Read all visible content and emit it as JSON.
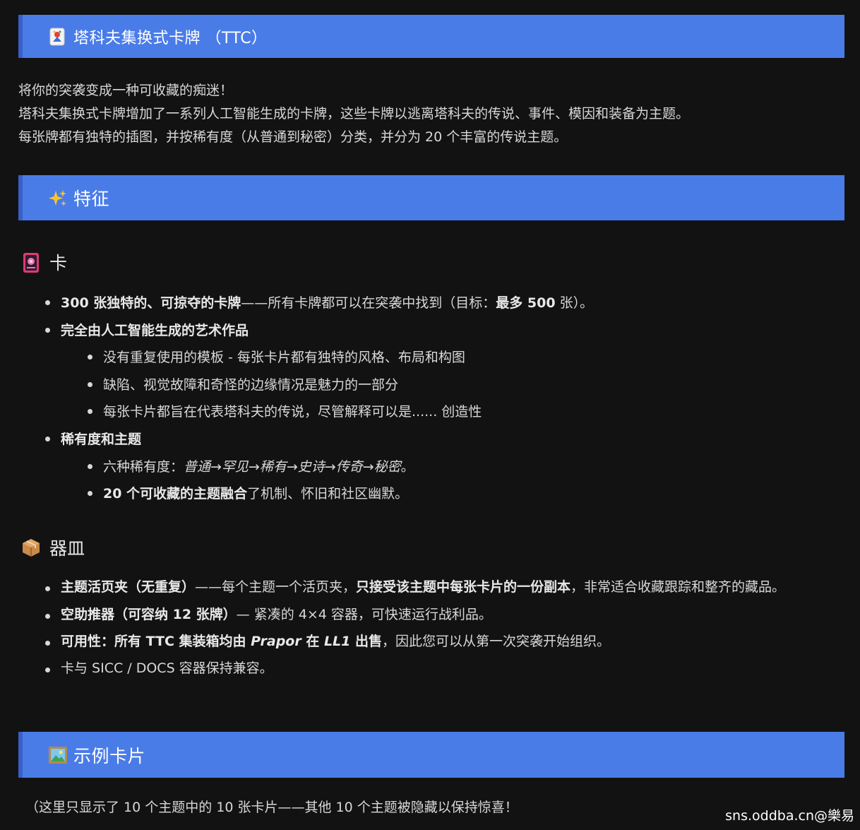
{
  "sections": {
    "ttc": {
      "icon": "joker-card-icon",
      "title": "塔科夫集换式卡牌 （TTC）"
    },
    "features": {
      "icon": "sparkles-icon",
      "title": "特征"
    },
    "samples": {
      "icon": "framed-picture-icon",
      "title": "示例卡片"
    }
  },
  "intro": {
    "line1": "将你的突袭变成一种可收藏的痴迷！",
    "line2": "塔科夫集换式卡牌增加了一系列人工智能生成的卡牌，这些卡牌以逃离塔科夫的传说、事件、模因和装备为主题。",
    "line3": "每张牌都有独特的插图，并按稀有度（从普通到秘密）分类，并分为 20 个丰富的传说主题。"
  },
  "cards": {
    "icon": "flower-playing-card-icon",
    "title": "卡",
    "item1": {
      "bold": "300 张独特的、可掠夺的卡牌",
      "text": "——所有卡牌都可以在突袭中找到（目标：",
      "bold2": "最多 500",
      "text2": " 张）。"
    },
    "item2": {
      "bold": "完全由人工智能生成的艺术作品",
      "sub1": "没有重复使用的模板 - 每张卡片都有独特的风格、布局和构图",
      "sub2": "缺陷、视觉故障和奇怪的边缘情况是魅力的一部分",
      "sub3": "每张卡片都旨在代表塔科夫的传说，尽管解释可以是...... 创造性"
    },
    "item3": {
      "bold": "稀有度和主题",
      "sub1_text": "六种稀有度：",
      "sub1_italic": "普通→罕见→稀有→史诗→传奇→秘密",
      "sub1_end": "。",
      "sub2_bold": "20 个可收藏的主题融合",
      "sub2_text": "了机制、怀旧和社区幽默。"
    }
  },
  "vessels": {
    "icon": "package-icon",
    "title": "器皿",
    "item1": {
      "bold": "主题活页夹（无重复）",
      "text": "——每个主题一个活页夹，",
      "bold2": "只接受该主题中每张卡片的一份副本",
      "text2": "，非常适合收藏跟踪和整齐的藏品。"
    },
    "item2": {
      "bold": "空助推器（可容纳 12 张牌）",
      "text": "— 紧凑的 4×4 容器，可快速运行战利品。"
    },
    "item3": {
      "bold": "可用性：所有 TTC 集装箱均由 ",
      "italic": "Prapor",
      "bold2": " 在 ",
      "italic2": "LL1",
      "bold3": " 出售",
      "text": "，因此您可以从第一次突袭开始组织。"
    },
    "item4": {
      "text": "卡与 SICC / DOCS 容器保持兼容。"
    }
  },
  "footer_note": "（这里只显示了 10 个主题中的 10 张卡片——其他 10 个主题被隐藏以保持惊喜！",
  "watermark": "sns.oddba.cn@樂易"
}
